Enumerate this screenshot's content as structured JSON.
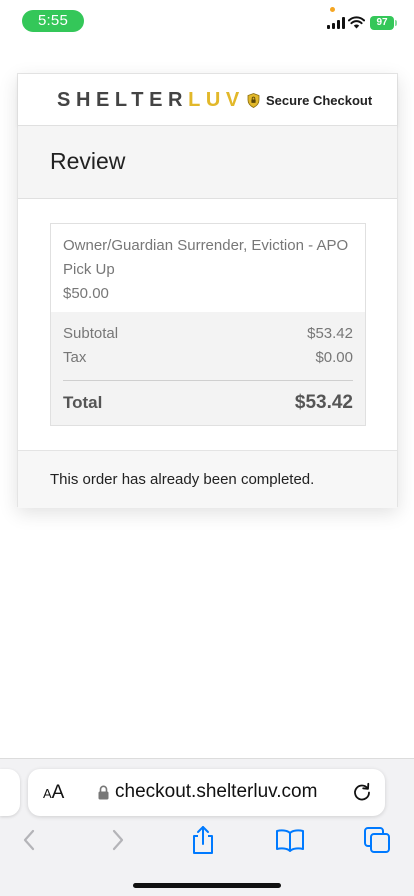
{
  "status_bar": {
    "time": "5:55",
    "battery": "97"
  },
  "brand": {
    "shelter": "SHELTER",
    "luv": "LUV",
    "secure_label": "Secure Checkout"
  },
  "review": {
    "title": "Review"
  },
  "order": {
    "item_name": "Owner/Guardian Surrender, Eviction - APO Pick Up",
    "item_price": "$50.00",
    "subtotal_label": "Subtotal",
    "subtotal_value": "$53.42",
    "tax_label": "Tax",
    "tax_value": "$0.00",
    "total_label": "Total",
    "total_value": "$53.42"
  },
  "message": "This order has already been completed.",
  "browser": {
    "aa_small": "A",
    "aa_large": "A",
    "url": "checkout.shelterluv.com"
  },
  "colors": {
    "accent_gold": "#e2b82a",
    "status_green": "#34c759",
    "ios_blue": "#007aff"
  },
  "icons": [
    "signal-icon",
    "wifi-icon",
    "battery-icon",
    "shield-icon",
    "lock-icon",
    "reload-icon",
    "back-icon",
    "forward-icon",
    "share-icon",
    "bookmarks-icon",
    "tabs-icon"
  ]
}
